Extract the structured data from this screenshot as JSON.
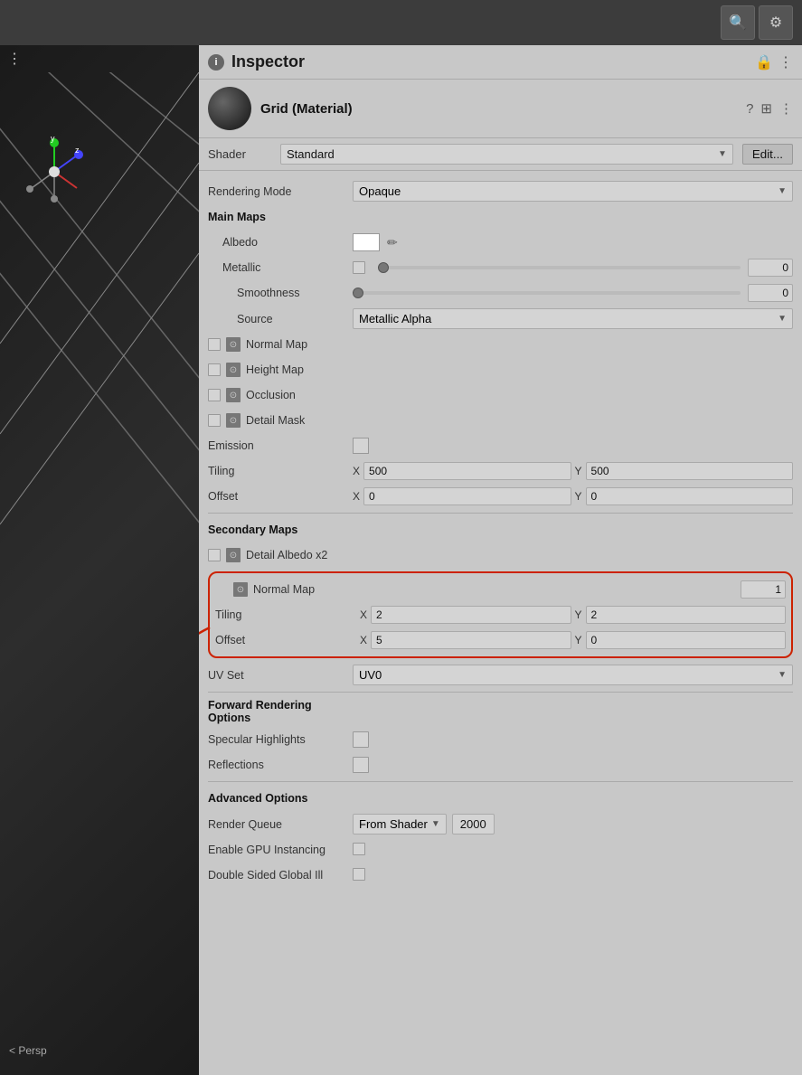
{
  "topbar": {
    "search_icon": "🔍",
    "gear_icon": "⚙"
  },
  "scene": {
    "persp_label": "< Persp"
  },
  "inspector": {
    "title": "Inspector",
    "lock_icon": "🔒",
    "more_icon": "⋮",
    "info_icon": "i"
  },
  "material": {
    "name": "Grid (Material)",
    "help_icon": "?",
    "settings_icon": "⊞",
    "more_icon": "⋮",
    "shader_label": "Shader",
    "shader_value": "Standard",
    "edit_label": "Edit..."
  },
  "rendering": {
    "mode_label": "Rendering Mode",
    "mode_value": "Opaque"
  },
  "main_maps": {
    "section_title": "Main Maps",
    "albedo_label": "Albedo",
    "albedo_color": "#ffffff",
    "metallic_label": "Metallic",
    "metallic_value": "0",
    "metallic_slider_pos": "0",
    "smoothness_label": "Smoothness",
    "smoothness_value": "0",
    "smoothness_slider_pos": "0",
    "source_label": "Source",
    "source_value": "Metallic Alpha",
    "normal_map_label": "Normal Map",
    "height_map_label": "Height Map",
    "occlusion_label": "Occlusion",
    "detail_mask_label": "Detail Mask",
    "emission_label": "Emission",
    "tiling_label": "Tiling",
    "tiling_x": "500",
    "tiling_y": "500",
    "offset_label": "Offset",
    "offset_x": "0",
    "offset_y": "0"
  },
  "secondary_maps": {
    "section_title": "Secondary Maps",
    "detail_albedo_label": "Detail Albedo x2",
    "normal_map_label": "Normal Map",
    "normal_map_value": "1",
    "tiling_label": "Tiling",
    "tiling_x": "2",
    "tiling_y": "2",
    "offset_label": "Offset",
    "offset_x": "5",
    "offset_y": "0",
    "uv_set_label": "UV Set",
    "uv_set_value": "UV0"
  },
  "forward_rendering": {
    "section_title": "Forward Rendering Options",
    "specular_label": "Specular Highlights",
    "reflections_label": "Reflections"
  },
  "advanced": {
    "section_title": "Advanced Options",
    "render_queue_label": "Render Queue",
    "render_queue_dropdown": "From Shader",
    "render_queue_value": "2000",
    "gpu_instancing_label": "Enable GPU Instancing",
    "double_sided_label": "Double Sided Global Ill"
  }
}
